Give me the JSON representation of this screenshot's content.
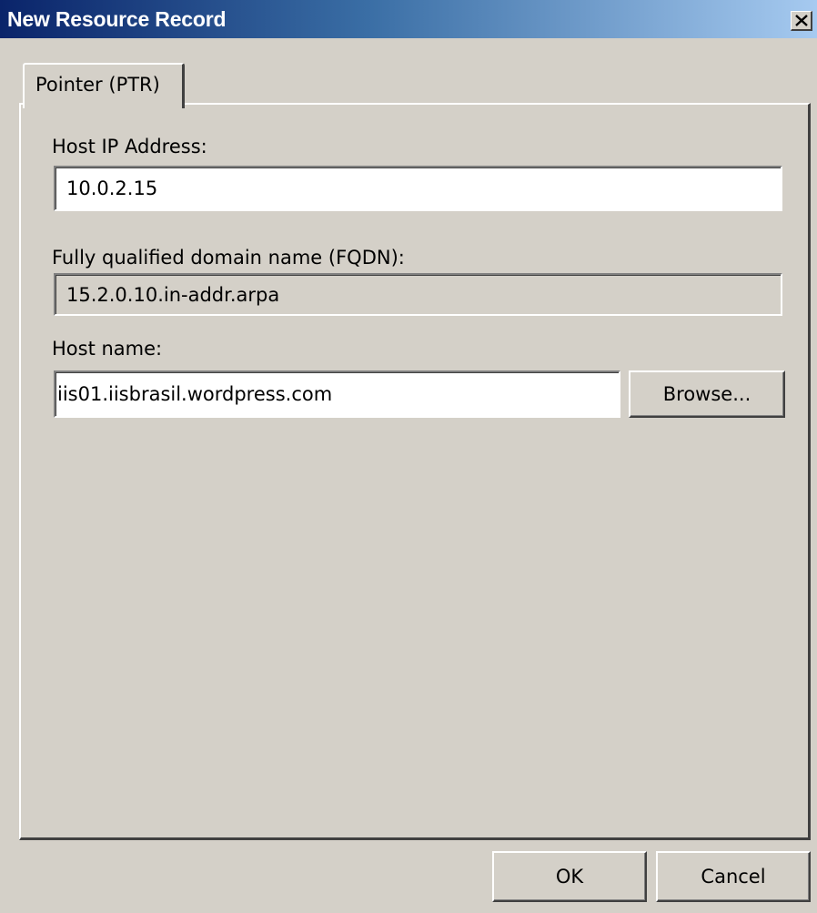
{
  "window": {
    "title": "New Resource Record",
    "close_glyph": "✕"
  },
  "tabs": [
    {
      "label": "Pointer (PTR)",
      "selected": true
    }
  ],
  "form": {
    "host_ip": {
      "label": "Host IP Address:",
      "value": "10.0.2.15"
    },
    "fqdn": {
      "label": "Fully qualified domain name (FQDN):",
      "value": "15.2.0.10.in-addr.arpa"
    },
    "host_name": {
      "label": "Host name:",
      "value": "iis01.iisbrasil.wordpress.com"
    },
    "browse_label": "Browse..."
  },
  "footer": {
    "ok_label": "OK",
    "cancel_label": "Cancel"
  },
  "icons": {
    "close": "close-icon"
  },
  "colors": {
    "title_gradient_start": "#0a246a",
    "title_gradient_end": "#a6caf0",
    "face": "#d4d0c8"
  }
}
